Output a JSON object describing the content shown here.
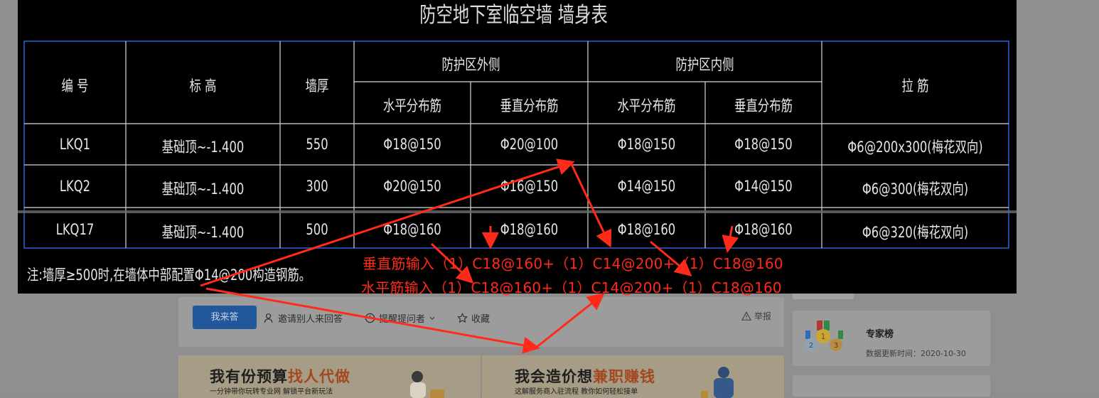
{
  "table": {
    "title": "防空地下室临空墙 墙身表",
    "headers": {
      "id": "编 号",
      "elevation": "标 高",
      "thickness": "墙厚",
      "outer_group": "防护区外侧",
      "inner_group": "防护区内侧",
      "horiz": "水平分布筋",
      "vert": "垂直分布筋",
      "tie": "拉 筋"
    },
    "rows": [
      [
        "LKQ1",
        "基础顶~-1.400",
        "550",
        "Φ18@150",
        "Φ20@100",
        "Φ18@150",
        "Φ18@150",
        "Φ6@200x300(梅花双向)"
      ],
      [
        "LKQ2",
        "基础顶~-1.400",
        "300",
        "Φ20@150",
        "Φ16@150",
        "Φ14@150",
        "Φ14@150",
        "Φ6@300(梅花双向)"
      ],
      [
        "LKQ17",
        "基础顶~-1.400",
        "500",
        "Φ18@160",
        "Φ18@160",
        "Φ18@160",
        "Φ18@160",
        "Φ6@320(梅花双向)"
      ]
    ],
    "note": "注:墙厚≥500时,在墙体中部配置Φ14@200构造钢筋。"
  },
  "annotations": {
    "vertical": "垂直筋输入（1）C18@160+（1）C14@200+（1）C18@160",
    "horizontal": "水平筋输入（1）C18@160+（1）C14@200+（1）C18@160",
    "color": "#ff2a1a"
  },
  "actions": {
    "answer": "我来答",
    "invite": "邀请别人来回答",
    "remind": "提醒提问者",
    "favorite": "收藏",
    "report": "举报"
  },
  "expert": {
    "title": "专家榜",
    "updated": "数据更新时间：2020-10-30"
  },
  "banners": {
    "left_title_a": "我有份预算",
    "left_title_b": "找人代做",
    "left_sub": "一分钟带你玩转专业网 解锁平台新玩法",
    "right_title_a": "我会造价想",
    "right_title_b": "兼职赚钱",
    "right_sub": "这解服务商入驻流程 教你如何轻松接单"
  },
  "colors": {
    "primary_button": "#23579b",
    "cad_bg": "#000000",
    "table_line": "#2a62d8"
  }
}
